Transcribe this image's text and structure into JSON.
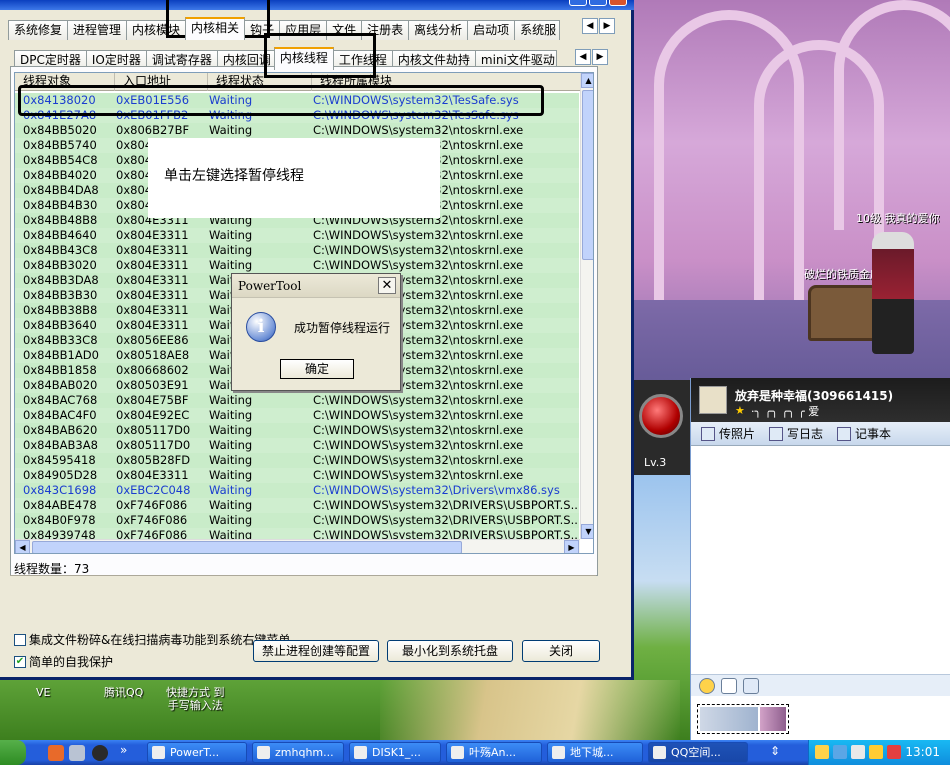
{
  "main_tabs": [
    "系统修复",
    "进程管理",
    "内核模块",
    "内核相关",
    "钩子",
    "应用层",
    "文件",
    "注册表",
    "离线分析",
    "启动项",
    "系统服"
  ],
  "main_tab_active": "内核相关",
  "sub_tabs": [
    "DPC定时器",
    "IO定时器",
    "调试寄存器",
    "内核回调",
    "内核线程",
    "工作线程",
    "内核文件劫持",
    "mini文件驱动"
  ],
  "sub_tab_active": "内核线程",
  "columns": [
    "线程对象",
    "入口地址",
    "线程状态",
    "线程所属模块"
  ],
  "rows": [
    {
      "obj": "0x84138020",
      "entry": "0xEB01E556",
      "state": "Waiting",
      "module": "C:\\WINDOWS\\system32\\TesSafe.sys",
      "blue": true
    },
    {
      "obj": "0x841E27A8",
      "entry": "0xEB01FFB2",
      "state": "Waiting",
      "module": "C:\\WINDOWS\\system32\\TesSafe.sys",
      "blue": true
    },
    {
      "obj": "0x84BB5020",
      "entry": "0x806B27BF",
      "state": "Waiting",
      "module": "C:\\WINDOWS\\system32\\ntoskrnl.exe"
    },
    {
      "obj": "0x84BB5740",
      "entry": "0x804E3311",
      "state": "Waiting",
      "module": "C:\\WINDOWS\\system32\\ntoskrnl.exe"
    },
    {
      "obj": "0x84BB54C8",
      "entry": "0x804E3311",
      "state": "Waiting",
      "module": "C:\\WINDOWS\\system32\\ntoskrnl.exe"
    },
    {
      "obj": "0x84BB4020",
      "entry": "0x804E3311",
      "state": "Waiting",
      "module": "C:\\WINDOWS\\system32\\ntoskrnl.exe"
    },
    {
      "obj": "0x84BB4DA8",
      "entry": "0x804E3311",
      "state": "Waiting",
      "module": "C:\\WINDOWS\\system32\\ntoskrnl.exe"
    },
    {
      "obj": "0x84BB4B30",
      "entry": "0x804E3311",
      "state": "Waiting",
      "module": "C:\\WINDOWS\\system32\\ntoskrnl.exe"
    },
    {
      "obj": "0x84BB48B8",
      "entry": "0x804E3311",
      "state": "Waiting",
      "module": "C:\\WINDOWS\\system32\\ntoskrnl.exe"
    },
    {
      "obj": "0x84BB4640",
      "entry": "0x804E3311",
      "state": "Waiting",
      "module": "C:\\WINDOWS\\system32\\ntoskrnl.exe"
    },
    {
      "obj": "0x84BB43C8",
      "entry": "0x804E3311",
      "state": "Waiting",
      "module": "C:\\WINDOWS\\system32\\ntoskrnl.exe"
    },
    {
      "obj": "0x84BB3020",
      "entry": "0x804E3311",
      "state": "Waiting",
      "module": "C:\\WINDOWS\\system32\\ntoskrnl.exe"
    },
    {
      "obj": "0x84BB3DA8",
      "entry": "0x804E3311",
      "state": "Waiting",
      "module": "C:\\WINDOWS\\system32\\ntoskrnl.exe"
    },
    {
      "obj": "0x84BB3B30",
      "entry": "0x804E3311",
      "state": "Waiting",
      "module": "C:\\WINDOWS\\system32\\ntoskrnl.exe"
    },
    {
      "obj": "0x84BB38B8",
      "entry": "0x804E3311",
      "state": "Waiting",
      "module": "C:\\WINDOWS\\system32\\ntoskrnl.exe"
    },
    {
      "obj": "0x84BB3640",
      "entry": "0x804E3311",
      "state": "Waiting",
      "module": "C:\\WINDOWS\\system32\\ntoskrnl.exe"
    },
    {
      "obj": "0x84BB33C8",
      "entry": "0x8056EE86",
      "state": "Waiting",
      "module": "C:\\WINDOWS\\system32\\ntoskrnl.exe"
    },
    {
      "obj": "0x84BB1AD0",
      "entry": "0x80518AE8",
      "state": "Waiting",
      "module": "C:\\WINDOWS\\system32\\ntoskrnl.exe"
    },
    {
      "obj": "0x84BB1858",
      "entry": "0x80668602",
      "state": "Waiting",
      "module": "C:\\WINDOWS\\system32\\ntoskrnl.exe"
    },
    {
      "obj": "0x84BAB020",
      "entry": "0x80503E91",
      "state": "Waiting",
      "module": "C:\\WINDOWS\\system32\\ntoskrnl.exe"
    },
    {
      "obj": "0x84BAC768",
      "entry": "0x804E75BF",
      "state": "Waiting",
      "module": "C:\\WINDOWS\\system32\\ntoskrnl.exe"
    },
    {
      "obj": "0x84BAC4F0",
      "entry": "0x804E92EC",
      "state": "Waiting",
      "module": "C:\\WINDOWS\\system32\\ntoskrnl.exe"
    },
    {
      "obj": "0x84BAB620",
      "entry": "0x805117D0",
      "state": "Waiting",
      "module": "C:\\WINDOWS\\system32\\ntoskrnl.exe"
    },
    {
      "obj": "0x84BAB3A8",
      "entry": "0x805117D0",
      "state": "Waiting",
      "module": "C:\\WINDOWS\\system32\\ntoskrnl.exe"
    },
    {
      "obj": "0x84595418",
      "entry": "0x805B28FD",
      "state": "Waiting",
      "module": "C:\\WINDOWS\\system32\\ntoskrnl.exe"
    },
    {
      "obj": "0x84905D28",
      "entry": "0x804E3311",
      "state": "Waiting",
      "module": "C:\\WINDOWS\\system32\\ntoskrnl.exe"
    },
    {
      "obj": "0x843C1698",
      "entry": "0xEBC2C048",
      "state": "Waiting",
      "module": "C:\\WINDOWS\\system32\\Drivers\\vmx86.sys",
      "blue": true
    },
    {
      "obj": "0x84ABE478",
      "entry": "0xF746F086",
      "state": "Waiting",
      "module": "C:\\WINDOWS\\system32\\DRIVERS\\USBPORT.S..."
    },
    {
      "obj": "0x84B0F978",
      "entry": "0xF746F086",
      "state": "Waiting",
      "module": "C:\\WINDOWS\\system32\\DRIVERS\\USBPORT.S..."
    },
    {
      "obj": "0x84939748",
      "entry": "0xF746F086",
      "state": "Waiting",
      "module": "C:\\WINDOWS\\system32\\DRIVERS\\USBPORT.S..."
    }
  ],
  "thread_count": "线程数量：73",
  "checkbox_integrate": "集成文件粉碎&在线扫描病毒功能到系统右键菜单",
  "checkbox_protect": "简单的自我保护",
  "btn_forbid": "禁止进程创建等配置",
  "btn_minimize": "最小化到系统托盘",
  "btn_close": "关闭",
  "callout_text": "单击左键选择暂停线程",
  "msgbox": {
    "title": "PowerTool",
    "message": "成功暂停线程运行",
    "ok": "确定",
    "icon": "info-icon"
  },
  "game": {
    "label1": "10级  我真的爱你",
    "label2": "破烂的铁质金库",
    "level": "Lv.3"
  },
  "qq": {
    "name": "放弃是种幸福(309661415)",
    "signature": "·╮ ╭╮ ╭╮ ╭ 爱",
    "tabs": [
      "传照片",
      "写日志",
      "记事本"
    ]
  },
  "desktop_icons": [
    "VE",
    "腾讯QQ",
    "快捷方式 到\n手写输入法"
  ],
  "taskbar": {
    "tasks": [
      "PowerT...",
      "zmhqhm...",
      "DISK1_...",
      "叶殇An...",
      "地下城...",
      "QQ空间..."
    ],
    "active_task": "QQ空间...",
    "clock": "13:01"
  }
}
